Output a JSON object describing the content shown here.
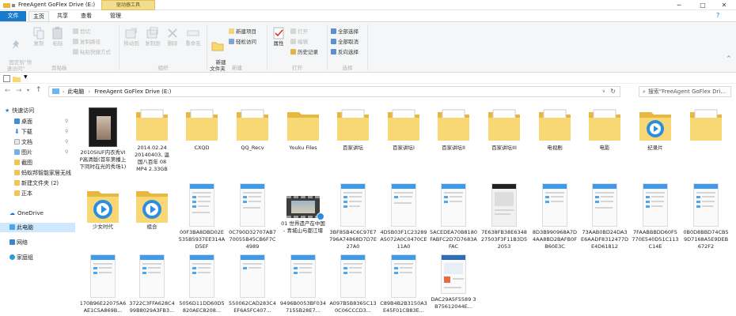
{
  "window": {
    "title": "FreeAgent GoFlex Drive (E:)",
    "context_header": "驱动器工具",
    "min": "─",
    "max": "□",
    "close": "✕"
  },
  "tabs": [
    "文件",
    "主页",
    "共享",
    "查看",
    "管理"
  ],
  "ribbon": {
    "pin_label": "固定到\"快\n速访问\"",
    "copy_label": "复制",
    "paste_label": "粘贴",
    "cut": "剪切",
    "copy_path": "复制路径",
    "paste_shortcut": "粘贴快捷方式",
    "move_to": "移动到",
    "copy_to": "复制到",
    "delete": "删除",
    "rename": "重命名",
    "new_folder": "新建\n文件夹",
    "new_item": "新建项目",
    "easy_access": "轻松访问",
    "properties": "属性",
    "open": "打开",
    "edit": "编辑",
    "history": "历史记录",
    "select_all": "全部选择",
    "select_none": "全部取消",
    "invert": "反向选择",
    "groups": [
      "剪贴板",
      "组织",
      "新建",
      "打开",
      "选择"
    ]
  },
  "address": {
    "path": "此电脑  ›  FreeAgent GoFlex Drive (E:)",
    "search_placeholder": "搜索\"FreeAgent GoFlex Dri...",
    "crumb_root": "此电脑",
    "crumb_drive": "FreeAgent GoFlex Drive (E:)"
  },
  "nav": {
    "quick_access": "快速访问",
    "items": [
      "桌面",
      "下载",
      "文档",
      "图片",
      "截图",
      "蚂蚁邦智能家居无线",
      "新建文件夹 (2)",
      "正本"
    ],
    "onedrive": "OneDrive",
    "this_pc": "此电脑",
    "network": "网络",
    "homegroup": "家庭组"
  },
  "files_row1": [
    {
      "name": "2010SIUF内衣秀VIP高清版(首年第播上下同时在光的秀场1)",
      "kind": "video-thumb"
    },
    {
      "name": "2014.02.24\n20140403, 温\n国八百年 08\nMP4 2.33GB",
      "kind": "folder"
    },
    {
      "name": "CXQD",
      "kind": "folder"
    },
    {
      "name": "QQ_Recv",
      "kind": "folder"
    },
    {
      "name": "Youku Files",
      "kind": "folder"
    },
    {
      "name": "百家讲坛",
      "kind": "folder"
    },
    {
      "name": "百家讲坛I",
      "kind": "folder"
    },
    {
      "name": "百家讲坛II",
      "kind": "folder"
    },
    {
      "name": "百家讲坛III",
      "kind": "folder"
    },
    {
      "name": "电视剧",
      "kind": "folder"
    },
    {
      "name": "电影",
      "kind": "folder-video"
    },
    {
      "name": "纪录片",
      "kind": "folder"
    }
  ],
  "files_row2": [
    {
      "name": "少女时代",
      "kind": "folder-video"
    },
    {
      "name": "组合",
      "kind": "folder-video"
    },
    {
      "name": "00F3BA8DBD02E535B5937EE314AD5EF",
      "kind": "phone"
    },
    {
      "name": "0C790D32707AB770055B45CB6F7C4989",
      "kind": "phone"
    },
    {
      "name": "01 世界遗产在中国 - 青城山与都江堰",
      "kind": "video"
    },
    {
      "name": "3BF85B4C6C97E7796A74868D7D7E27A0",
      "kind": "phone"
    },
    {
      "name": "4D5B03F1C23289A5072A0C0470CE11A0",
      "kind": "phone"
    },
    {
      "name": "5ACEDEA70B8180FABFC2D7D7683AFAC",
      "kind": "phone"
    },
    {
      "name": "7E638FB38E634827503F3F11B3D52053",
      "kind": "phone"
    },
    {
      "name": "8D3B990968A7D4AA8BD2BAFB0FB60E3C",
      "kind": "phone"
    },
    {
      "name": "73AAB0BD24DA3E6AADF8312477DE4D61812",
      "kind": "phone"
    },
    {
      "name": "7FAABBBDD60F5770E540D51C113C14E",
      "kind": "phone"
    },
    {
      "name": "0B0D8BBD74CB59D7168A5E9DEB672F2",
      "kind": "phone"
    }
  ],
  "files_row3": [
    {
      "name": "170B96E22075A6AE1C5A869B...",
      "kind": "phone"
    },
    {
      "name": "3722C3FFA628C499B8029A3FB3...",
      "kind": "phone"
    },
    {
      "name": "5056D11DD60D5820AEC8208...",
      "kind": "phone"
    },
    {
      "name": "550062CAD283C4EF6A5FC407...",
      "kind": "phone"
    },
    {
      "name": "9496B0053BF0347155B28E7...",
      "kind": "phone"
    },
    {
      "name": "A097B5B8365C130C06CCCD3...",
      "kind": "phone"
    },
    {
      "name": "C89B4B2B3150A3E45F01CB83E...",
      "kind": "phone"
    },
    {
      "name": "DAC29A5F5589 3B75612044E...",
      "kind": "phone-card"
    }
  ],
  "colors": {
    "folder": "#f8d775",
    "folder_dark": "#e8b73f",
    "accent": "#1979ca",
    "selection": "#cde8ff",
    "media_blue": "#2a8fe0"
  }
}
